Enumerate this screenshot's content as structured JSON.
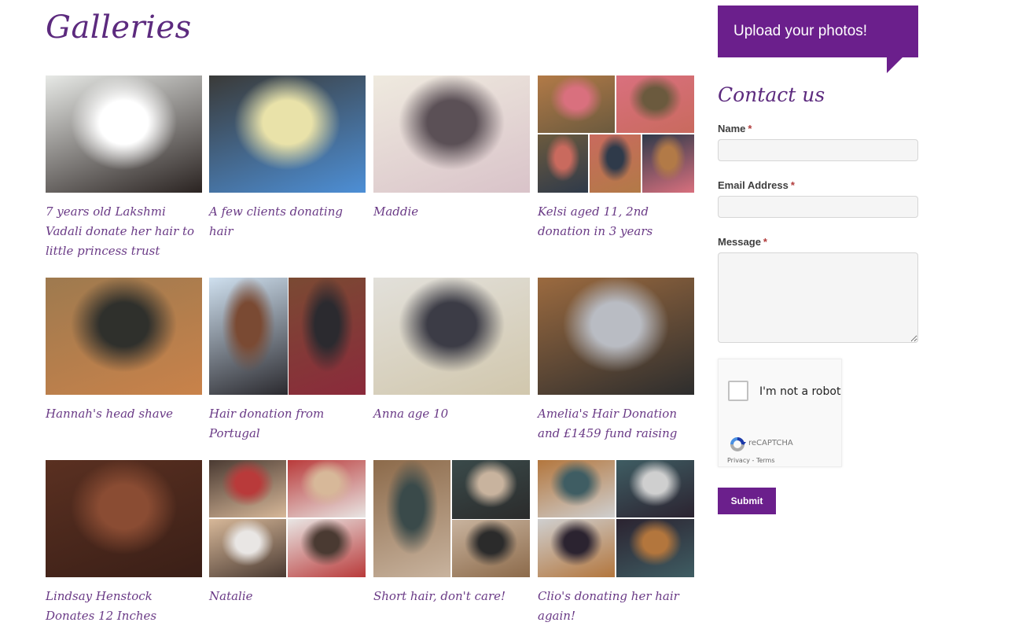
{
  "page": {
    "title": "Galleries"
  },
  "galleries": [
    {
      "caption": "7 years old Lakshmi Vadali donate her hair to little princess trust",
      "thumb": {
        "layout": "single",
        "colors": [
          "#e7e9e6",
          "#ffffff",
          "#2a2321",
          "#d93b8a"
        ]
      }
    },
    {
      "caption": "A few clients donating hair",
      "thumb": {
        "layout": "single",
        "colors": [
          "#3a3a38",
          "#e9e2a9",
          "#4d8fd6",
          "#f3a3c2"
        ]
      }
    },
    {
      "caption": "Maddie",
      "thumb": {
        "layout": "single",
        "colors": [
          "#efeadf",
          "#5b5056",
          "#d9c3c9",
          "#c9b48e"
        ]
      }
    },
    {
      "caption": "Kelsi aged 11, 2nd donation in 3 years",
      "thumb": {
        "layout": "collage5",
        "colors": [
          "#b27a47",
          "#d9707e",
          "#6b5a3e",
          "#c96a5e",
          "#2f3a4a"
        ]
      }
    },
    {
      "caption": "Hannah's head shave",
      "thumb": {
        "layout": "single",
        "colors": [
          "#9e7a4f",
          "#2f302c",
          "#c9824a",
          "#e3c9a0"
        ]
      }
    },
    {
      "caption": "Hair donation from Portugal",
      "thumb": {
        "layout": "collage2",
        "colors": [
          "#cfe0ef",
          "#7a4a33",
          "#2b2a2f",
          "#8b2a3b"
        ]
      }
    },
    {
      "caption": "Anna age 10",
      "thumb": {
        "layout": "single",
        "colors": [
          "#e2e0da",
          "#3c3c46",
          "#d1c7ad",
          "#8b5a32"
        ]
      }
    },
    {
      "caption": "Amelia's Hair Donation and £1459 fund raising",
      "thumb": {
        "layout": "single",
        "colors": [
          "#9b6a3f",
          "#b9bcc3",
          "#2d2d2d",
          "#e4c995"
        ]
      }
    },
    {
      "caption": "Lindsay Henstock Donates 12 Inches",
      "thumb": {
        "layout": "single",
        "colors": [
          "#5a3021",
          "#8a4c33",
          "#3a1f17",
          "#e8e3df"
        ]
      }
    },
    {
      "caption": "Natalie",
      "thumb": {
        "layout": "collage4",
        "colors": [
          "#4a3a32",
          "#b93a3a",
          "#d7b899",
          "#e9e6e4"
        ]
      }
    },
    {
      "caption": "Short hair, don't care!",
      "thumb": {
        "layout": "collage3",
        "colors": [
          "#8c6a4a",
          "#3a4a4a",
          "#c8b39e",
          "#2b2b2b"
        ]
      }
    },
    {
      "caption": "Clio's donating her hair again!",
      "thumb": {
        "layout": "collage4",
        "colors": [
          "#b3763d",
          "#3f5d63",
          "#cfcfcf",
          "#2b2330"
        ]
      }
    }
  ],
  "sidebar": {
    "upload_label": "Upload your photos!",
    "contact_title": "Contact us",
    "form": {
      "name_label": "Name",
      "email_label": "Email Address",
      "message_label": "Message",
      "required_mark": "*",
      "name_value": "",
      "email_value": "",
      "message_value": "",
      "submit_label": "Submit"
    },
    "captcha": {
      "label": "I'm not a robot",
      "brand": "reCAPTCHA",
      "links": "Privacy - Terms"
    }
  },
  "colors": {
    "brand_purple": "#6b1f8c",
    "heading_purple": "#5c2a7e",
    "caption_purple": "#6a3a86"
  }
}
